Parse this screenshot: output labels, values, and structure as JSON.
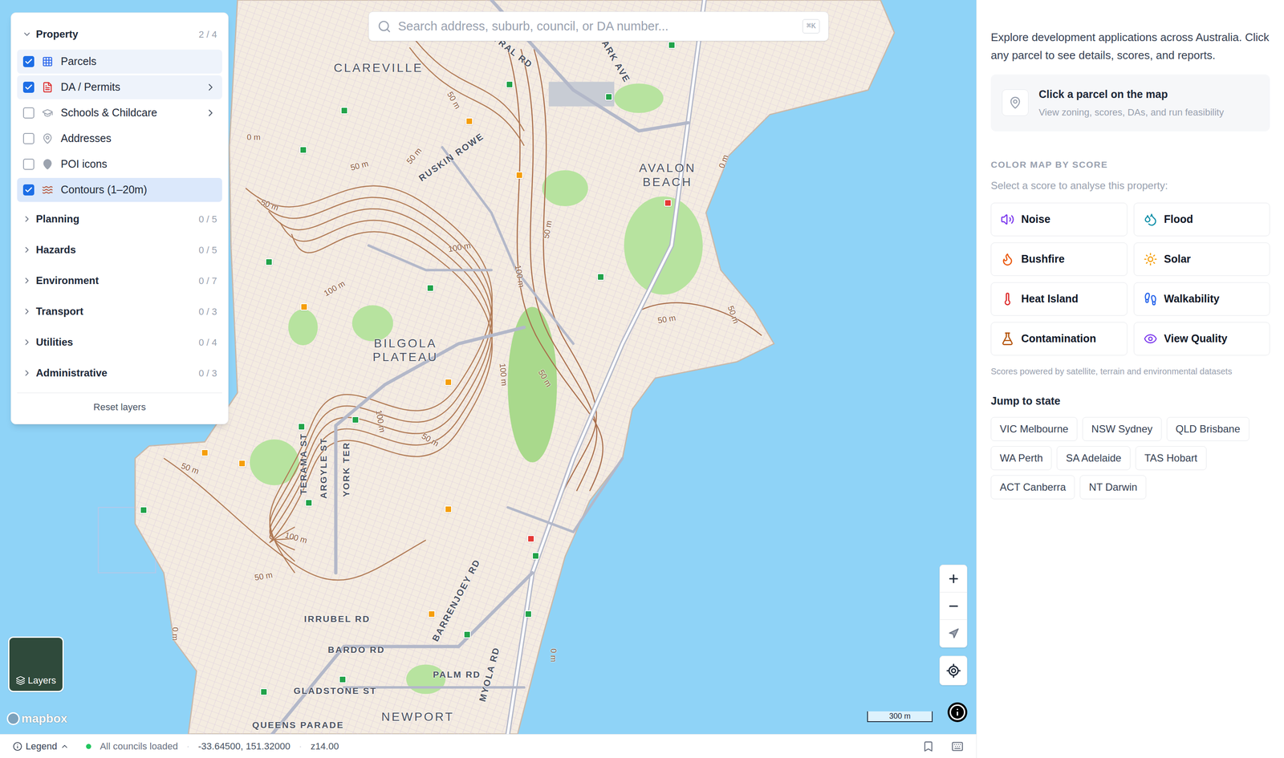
{
  "search": {
    "placeholder": "Search address, suburb, council, or DA number...",
    "shortcut": "⌘K"
  },
  "layers_panel": {
    "groups": [
      {
        "label": "Property",
        "count": "2 / 4",
        "expanded": true,
        "items": [
          {
            "label": "Parcels",
            "checked": true,
            "has_submenu": false,
            "selected": false
          },
          {
            "label": "DA / Permits",
            "checked": true,
            "has_submenu": true,
            "selected": false
          },
          {
            "label": "Schools & Childcare",
            "checked": false,
            "has_submenu": true,
            "selected": false
          },
          {
            "label": "Addresses",
            "checked": false,
            "has_submenu": false,
            "selected": false
          },
          {
            "label": "POI icons",
            "checked": false,
            "has_submenu": false,
            "selected": false
          },
          {
            "label": "Contours (1–20m)",
            "checked": true,
            "has_submenu": false,
            "selected": true
          }
        ]
      },
      {
        "label": "Planning",
        "count": "0 / 5",
        "expanded": false,
        "items": []
      },
      {
        "label": "Hazards",
        "count": "0 / 5",
        "expanded": false,
        "items": []
      },
      {
        "label": "Environment",
        "count": "0 / 7",
        "expanded": false,
        "items": []
      },
      {
        "label": "Transport",
        "count": "0 / 3",
        "expanded": false,
        "items": []
      },
      {
        "label": "Utilities",
        "count": "0 / 4",
        "expanded": false,
        "items": []
      },
      {
        "label": "Administrative",
        "count": "0 / 3",
        "expanded": false,
        "items": []
      }
    ],
    "reset": "Reset layers"
  },
  "map": {
    "places": [
      "CLAREVILLE",
      "AVALON BEACH",
      "BILGOLA PLATEAU",
      "NEWPORT"
    ],
    "streets": [
      "ENTRAL RD",
      "PARK AVE",
      "RUSKIN ROWE",
      "TERAMA ST",
      "ARGYLE ST",
      "YORK TER",
      "IRRUBEL RD",
      "BARDO RD",
      "BARRENJOEY RD",
      "PALM RD",
      "MYOLA RD",
      "GLADSTONE ST",
      "QUEENS PARADE"
    ],
    "contour_labels": [
      "0 m",
      "50 m",
      "50 m",
      "50 m",
      "50 m",
      "100 m",
      "100 m",
      "50 m",
      "100 m",
      "50 m",
      "100 m",
      "100 m",
      "50 m",
      "50 m",
      "50 m",
      "50 m",
      "100 m",
      "50 m",
      "0 m",
      "0 m",
      "0 m"
    ],
    "markers": [
      {
        "color": "#22a34a"
      },
      {
        "color": "#22a34a"
      },
      {
        "color": "#22a34a"
      },
      {
        "color": "#22a34a"
      },
      {
        "color": "#22a34a"
      },
      {
        "color": "#22a34a"
      },
      {
        "color": "#22a34a"
      },
      {
        "color": "#22a34a"
      },
      {
        "color": "#22a34a"
      },
      {
        "color": "#22a34a"
      },
      {
        "color": "#22a34a"
      },
      {
        "color": "#22a34a"
      },
      {
        "color": "#22a34a"
      },
      {
        "color": "#22a34a"
      },
      {
        "color": "#22a34a"
      },
      {
        "color": "#22a34a"
      },
      {
        "color": "#22a34a"
      },
      {
        "color": "#e53935"
      },
      {
        "color": "#e53935"
      },
      {
        "color": "#f59e0b"
      },
      {
        "color": "#f59e0b"
      },
      {
        "color": "#f59e0b"
      },
      {
        "color": "#f59e0b"
      },
      {
        "color": "#f59e0b"
      },
      {
        "color": "#f59e0b"
      },
      {
        "color": "#f59e0b"
      },
      {
        "color": "#f59e0b"
      }
    ],
    "layers_button": "Layers",
    "attribution": "mapbox",
    "scale": "300 m"
  },
  "status_bar": {
    "legend": "Legend",
    "councils": "All councils loaded",
    "councils_color": "#22c55e",
    "separator": "·",
    "coordinates": "-33.64500, 151.32000",
    "zoom": "z14.00"
  },
  "side_panel": {
    "intro": "Explore development applications across Australia. Click any parcel to see details, scores, and reports.",
    "prompt_card": {
      "title": "Click a parcel on the map",
      "subtitle": "View zoning, scores, DAs, and run feasibility"
    },
    "score_section": {
      "title": "COLOR MAP BY SCORE",
      "subtitle": "Select a score to analyse this property:",
      "scores": [
        {
          "label": "Noise",
          "color": "#7c3aed",
          "selected": false
        },
        {
          "label": "Flood",
          "color": "#0e8fa8",
          "selected": false
        },
        {
          "label": "Bushfire",
          "color": "#ea580c",
          "selected": false
        },
        {
          "label": "Solar",
          "color": "#f59e0b",
          "selected": false
        },
        {
          "label": "Heat Island",
          "color": "#dc2626",
          "selected": false
        },
        {
          "label": "Walkability",
          "color": "#2563eb",
          "selected": false
        },
        {
          "label": "Contamination",
          "color": "#b45309",
          "selected": false
        },
        {
          "label": "View Quality",
          "color": "#7c3aed",
          "selected": false
        }
      ],
      "note": "Scores powered by satellite, terrain and environmental datasets"
    },
    "states": {
      "title": "Jump to state",
      "items": [
        "VIC Melbourne",
        "NSW Sydney",
        "QLD Brisbane",
        "WA Perth",
        "SA Adelaide",
        "TAS Hobart",
        "ACT Canberra",
        "NT Darwin"
      ]
    }
  }
}
